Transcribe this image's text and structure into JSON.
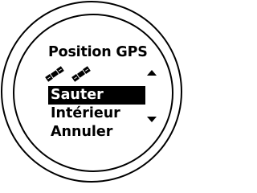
{
  "screen": {
    "title": "Position GPS",
    "satellite_icon": "satellite-icon"
  },
  "menu": {
    "items": [
      {
        "label": "Sauter",
        "selected": true
      },
      {
        "label": "Intérieur",
        "selected": false
      },
      {
        "label": "Annuler",
        "selected": false
      }
    ]
  },
  "scroll": {
    "up_icon": "arrow-up-icon",
    "down_icon": "arrow-down-icon"
  }
}
